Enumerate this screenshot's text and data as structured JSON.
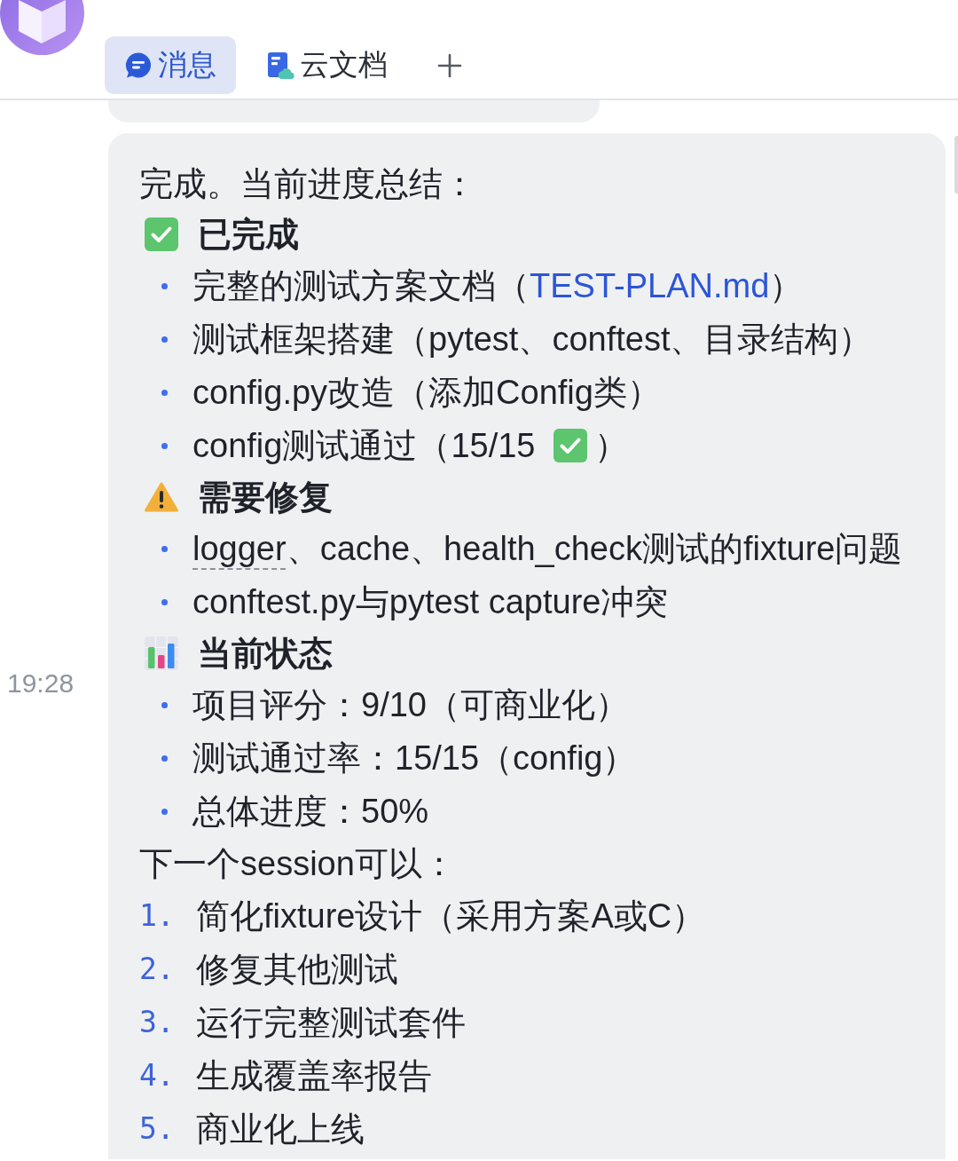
{
  "header": {
    "tabs": [
      {
        "kind": "chat",
        "label": "消息",
        "selected": true
      },
      {
        "kind": "docs",
        "label": "云文档",
        "selected": false
      }
    ]
  },
  "message": {
    "time": "19:28",
    "blocks": [
      {
        "kind": "paragraph",
        "text": "完成。当前进度总结："
      },
      {
        "kind": "section",
        "heading": {
          "kind": "done",
          "title": "已完成"
        },
        "items": [
          {
            "segments": [
              {
                "kind": "text",
                "text": "完整的测试方案文档（"
              },
              {
                "kind": "link",
                "text": "TEST-PLAN.md"
              },
              {
                "kind": "text",
                "text": "）"
              }
            ]
          },
          {
            "segments": [
              {
                "kind": "text",
                "text": "测试框架搭建（pytest、conftest、目录结构）"
              }
            ]
          },
          {
            "segments": [
              {
                "kind": "text",
                "text": "config.py改造（添加Config类）"
              }
            ]
          },
          {
            "segments": [
              {
                "kind": "text",
                "text": "config测试通过（15/15"
              },
              {
                "kind": "icon"
              },
              {
                "kind": "text",
                "text": "）"
              }
            ]
          }
        ]
      },
      {
        "kind": "section",
        "heading": {
          "kind": "warning",
          "title": "需要修复"
        },
        "items": [
          {
            "segments": [
              {
                "kind": "term",
                "text": "logger"
              },
              {
                "kind": "text",
                "text": "、cache、health_check测试的fixture问题"
              }
            ]
          },
          {
            "segments": [
              {
                "kind": "text",
                "text": "conftest.py与pytest capture冲突"
              }
            ]
          }
        ]
      },
      {
        "kind": "section",
        "heading": {
          "kind": "stats",
          "title": "当前状态"
        },
        "items": [
          {
            "segments": [
              {
                "kind": "text",
                "text": "项目评分：9/10（可商业化）"
              }
            ]
          },
          {
            "segments": [
              {
                "kind": "text",
                "text": "测试通过率：15/15（config）"
              }
            ]
          },
          {
            "segments": [
              {
                "kind": "text",
                "text": "总体进度：50%"
              }
            ]
          }
        ]
      },
      {
        "kind": "paragraph",
        "text": "下一个session可以："
      },
      {
        "kind": "ordered_list",
        "items": [
          {
            "marker": "1.",
            "text": "简化fixture设计（采用方案A或C）"
          },
          {
            "marker": "2.",
            "text": "修复其他测试"
          },
          {
            "marker": "3.",
            "text": "运行完整测试套件"
          },
          {
            "marker": "4.",
            "text": "生成覆盖率报告"
          },
          {
            "marker": "5.",
            "text": "商业化上线"
          }
        ]
      }
    ]
  }
}
